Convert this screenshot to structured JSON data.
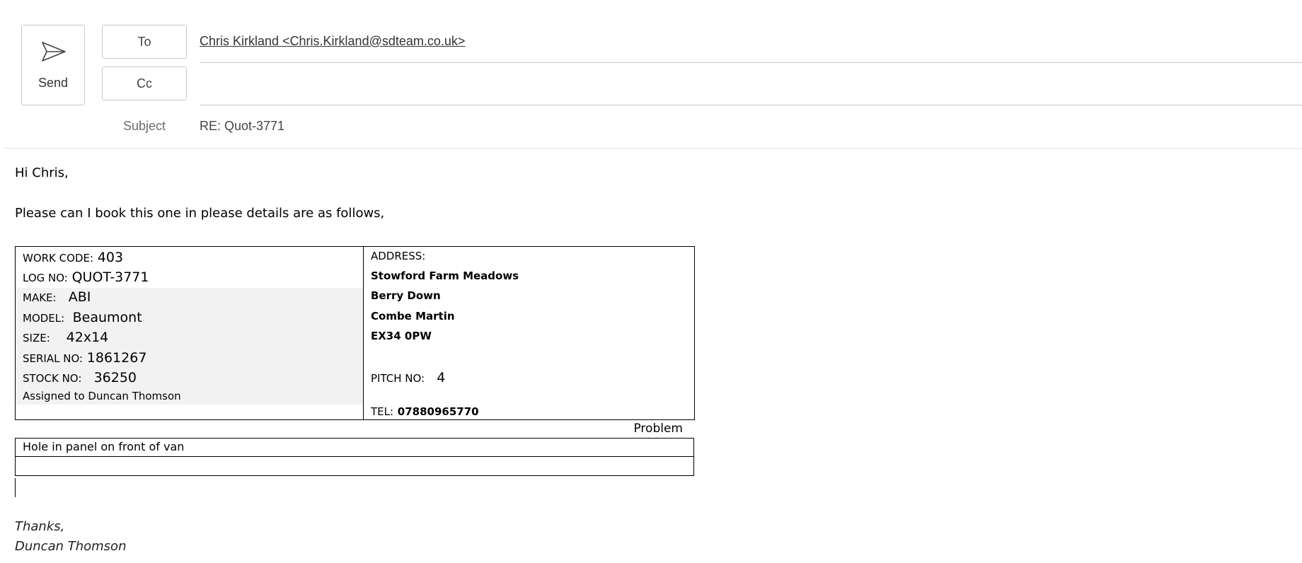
{
  "compose": {
    "send_label": "Send",
    "to_label": "To",
    "cc_label": "Cc",
    "subject_label": "Subject",
    "to_recipient": "Chris Kirkland <Chris.Kirkland@sdteam.co.uk>",
    "cc_value": "",
    "subject_value": "RE: Quot-3771"
  },
  "body": {
    "greeting": "Hi Chris,",
    "intro": "Please can I book this one in please details are as follows,",
    "details": {
      "work_code_label": "WORK CODE:",
      "work_code": "403",
      "log_no_label": "LOG NO:",
      "log_no": "QUOT-3771",
      "make_label": "MAKE:",
      "make": "ABI",
      "model_label": "MODEL:",
      "model": "Beaumont",
      "size_label": "SIZE:",
      "size": "42x14",
      "serial_label": "SERIAL NO:",
      "serial": "1861267",
      "stock_label": "STOCK NO:",
      "stock": "36250",
      "assigned": "Assigned to Duncan Thomson",
      "address_label": "ADDRESS:",
      "address_lines": [
        "Stowford Farm Meadows",
        "Berry Down",
        "Combe Martin",
        "EX34 0PW"
      ],
      "pitch_label": "PITCH NO:",
      "pitch": "4",
      "tel_label": "TEL:",
      "tel": "07880965770"
    },
    "problem_heading": "Problem",
    "problem_text": "Hole in panel on front of van",
    "signoff": "Thanks,",
    "signature": "Duncan Thomson"
  },
  "icons": {
    "send": "send-paper-plane-icon"
  }
}
